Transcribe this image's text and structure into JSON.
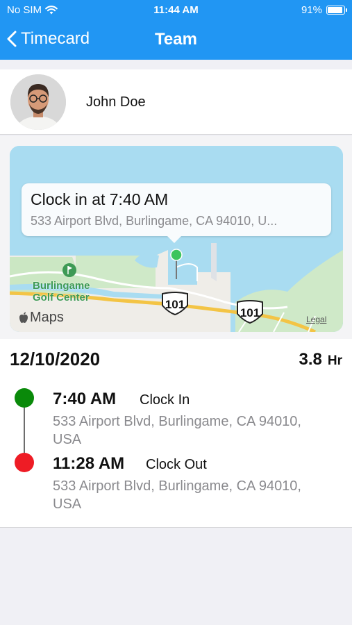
{
  "status_bar": {
    "carrier": "No SIM",
    "time": "11:44 AM",
    "battery": "91%",
    "battery_level": 0.91
  },
  "nav": {
    "back_label": "Timecard",
    "title": "Team"
  },
  "profile": {
    "name": "John Doe"
  },
  "map": {
    "callout_title": "Clock in at 7:40 AM",
    "callout_address": "533 Airport Blvd, Burlingame, CA 94010, U...",
    "poi_label": "Burlingame Golf Center",
    "highway_1": "101",
    "highway_2": "101",
    "logo_text": "Maps",
    "legal": "Legal"
  },
  "summary": {
    "date": "12/10/2020",
    "hours": "3.8",
    "hours_unit": "Hr"
  },
  "entries": [
    {
      "time": "7:40 AM",
      "type": "Clock In",
      "address": "533 Airport Blvd, Burlingame, CA 94010, USA",
      "color": "#0a8a0a"
    },
    {
      "time": "11:28 AM",
      "type": "Clock Out",
      "address": "533 Airport Blvd, Burlingame, CA 94010, USA",
      "color": "#ee1c25"
    }
  ],
  "colors": {
    "header": "#2196f3",
    "clock_in": "#0a8a0a",
    "clock_out": "#ee1c25"
  }
}
